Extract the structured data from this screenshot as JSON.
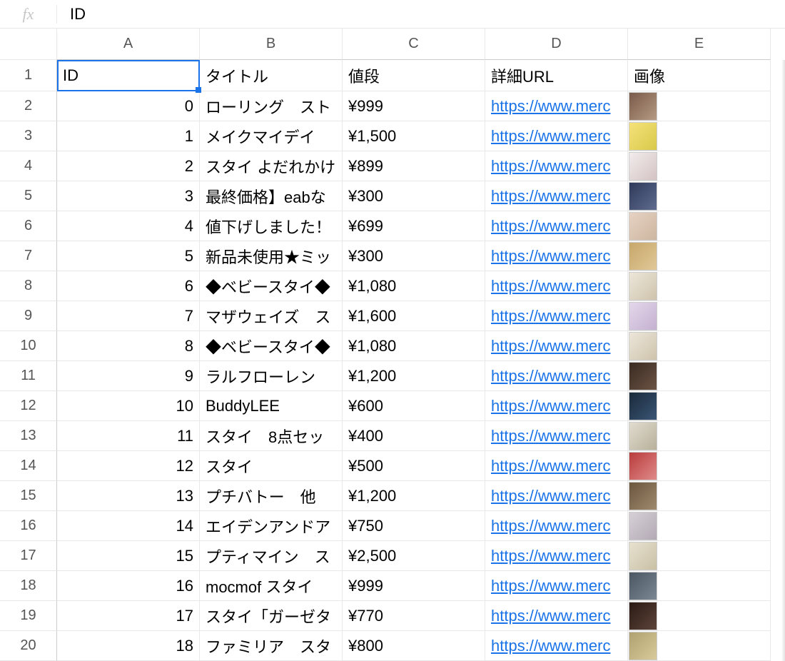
{
  "formula_bar": {
    "fx_label": "fx",
    "value": "ID"
  },
  "columns": {
    "A": "A",
    "B": "B",
    "C": "C",
    "D": "D",
    "E": "E"
  },
  "row_numbers": [
    "1",
    "2",
    "3",
    "4",
    "5",
    "6",
    "7",
    "8",
    "9",
    "10",
    "11",
    "12",
    "13",
    "14",
    "15",
    "16",
    "17",
    "18",
    "19",
    "20"
  ],
  "header_row": {
    "A": "ID",
    "B": "タイトル",
    "C": "値段",
    "D": "詳細URL",
    "E": "画像"
  },
  "link_display": "https://www.merc",
  "rows": [
    {
      "id": "0",
      "title": "ローリング　スト",
      "price": "¥999"
    },
    {
      "id": "1",
      "title": "メイクマイデイ",
      "price": "¥1,500"
    },
    {
      "id": "2",
      "title": "スタイ よだれかけ",
      "price": "¥899"
    },
    {
      "id": "3",
      "title": "最終価格】eabな",
      "price": "¥300"
    },
    {
      "id": "4",
      "title": "値下げしました！",
      "price": "¥699"
    },
    {
      "id": "5",
      "title": "新品未使用★ミッ",
      "price": "¥300"
    },
    {
      "id": "6",
      "title": "◆ベビースタイ◆",
      "price": "¥1,080"
    },
    {
      "id": "7",
      "title": "マザウェイズ　ス",
      "price": "¥1,600"
    },
    {
      "id": "8",
      "title": "◆ベビースタイ◆",
      "price": "¥1,080"
    },
    {
      "id": "9",
      "title": "ラルフローレン ",
      "price": "¥1,200"
    },
    {
      "id": "10",
      "title": "BuddyLEE",
      "price": "¥600"
    },
    {
      "id": "11",
      "title": "スタイ　8点セッ",
      "price": "¥400"
    },
    {
      "id": "12",
      "title": "スタイ",
      "price": "¥500"
    },
    {
      "id": "13",
      "title": "プチバトー　他",
      "price": "¥1,200"
    },
    {
      "id": "14",
      "title": "エイデンアンドア",
      "price": "¥750"
    },
    {
      "id": "15",
      "title": "プティマイン　ス",
      "price": "¥2,500"
    },
    {
      "id": "16",
      "title": "mocmof スタイ",
      "price": "¥999"
    },
    {
      "id": "17",
      "title": "スタイ「ガーゼタ",
      "price": "¥770"
    },
    {
      "id": "18",
      "title": "ファミリア　スタ",
      "price": "¥800"
    }
  ]
}
